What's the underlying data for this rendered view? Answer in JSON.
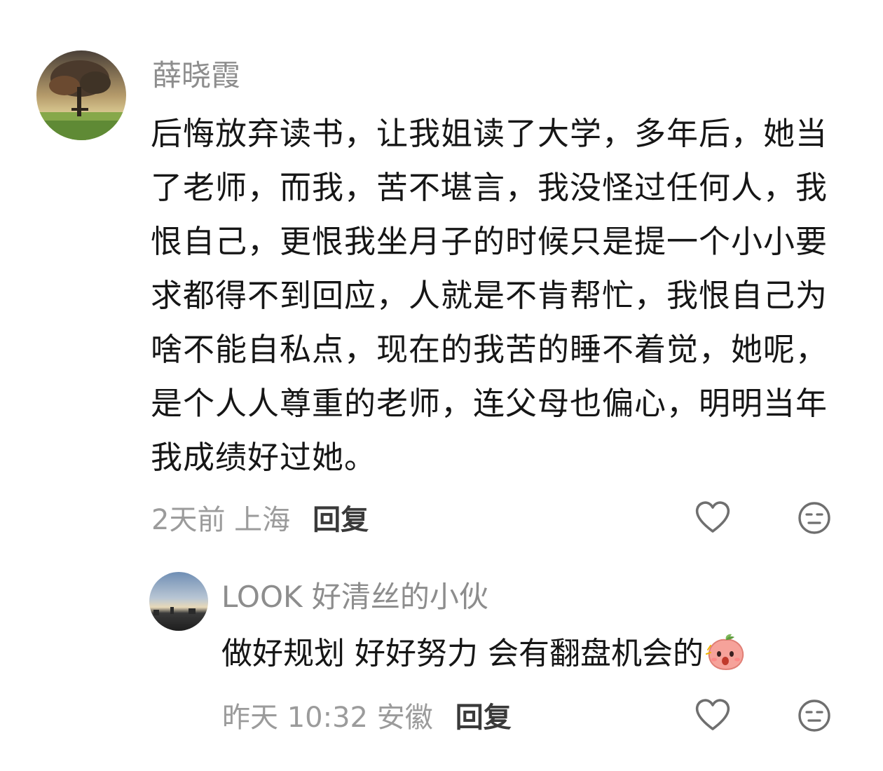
{
  "comments": [
    {
      "username": "薛晓霞",
      "avatar_icon": "tree-landscape-avatar",
      "text": "后悔放弃读书，让我姐读了大学，多年后，她当了老师，而我，苦不堪言，我没怪过任何人，我恨自己，更恨我坐月子的时候只是提一个小小要求都得不到回应，人就是不肯帮忙，我恨自己为啥不能自私点，现在的我苦的睡不着觉，她呢，是个人人尊重的老师，连父母也偏心，明明当年我成绩好过她。",
      "time_location": "2天前 上海",
      "reply_label": "回复",
      "like_icon": "heart-outline-icon",
      "dislike_icon": "meh-face-icon"
    },
    {
      "username": "LOOK 好清丝的小伙",
      "avatar_icon": "dusk-city-avatar",
      "text": "做好规划 好好努力 会有翻盘机会的",
      "emoji": "peach-emoji-icon",
      "time_location": "昨天 10:32 安徽",
      "reply_label": "回复",
      "like_icon": "heart-outline-icon",
      "dislike_icon": "meh-face-icon"
    }
  ],
  "colors": {
    "username": "#8d8d8d",
    "text": "#161616",
    "meta": "#9b9b9b",
    "icon": "#6f6f6f"
  }
}
